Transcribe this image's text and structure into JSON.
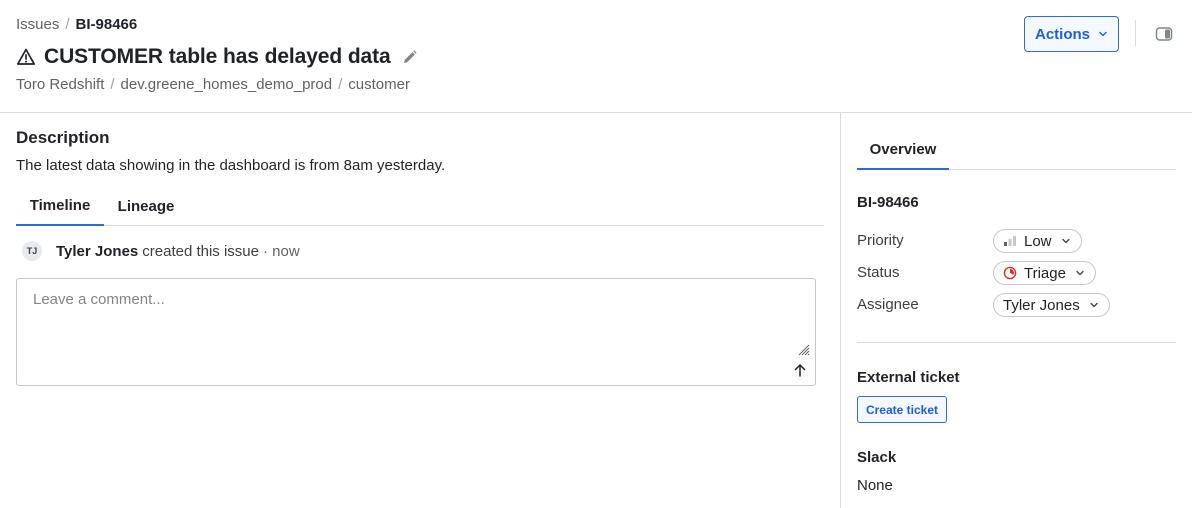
{
  "breadcrumb": {
    "root": "Issues",
    "separator": "/",
    "current": "BI-98466"
  },
  "issue": {
    "title": "CUSTOMER table has delayed data",
    "path": [
      "Toro Redshift",
      "dev.greene_homes_demo_prod",
      "customer"
    ]
  },
  "header": {
    "actions_label": "Actions"
  },
  "description": {
    "heading": "Description",
    "text": "The latest data showing in the dashboard is from 8am yesterday."
  },
  "tabs": [
    {
      "label": "Timeline"
    },
    {
      "label": "Lineage"
    }
  ],
  "timeline": [
    {
      "initials": "TJ",
      "user": "Tyler Jones",
      "action": "created this issue",
      "time": "· now"
    }
  ],
  "comment": {
    "placeholder": "Leave a comment..."
  },
  "side": {
    "tab": "Overview",
    "id": "BI-98466",
    "priority_label": "Priority",
    "priority_value": "Low",
    "status_label": "Status",
    "status_value": "Triage",
    "assignee_label": "Assignee",
    "assignee_value": "Tyler Jones",
    "external_ticket_heading": "External ticket",
    "create_ticket_label": "Create ticket",
    "slack_heading": "Slack",
    "slack_value": "None"
  },
  "colors": {
    "accent": "#2f6ad9",
    "status_triage": "#d93025"
  },
  "icons": [
    "warning-icon",
    "pencil-icon",
    "chevron-down-icon",
    "panel-toggle-icon",
    "priority-low-icon",
    "status-triage-icon",
    "resize-grip-icon",
    "arrow-up-icon"
  ]
}
